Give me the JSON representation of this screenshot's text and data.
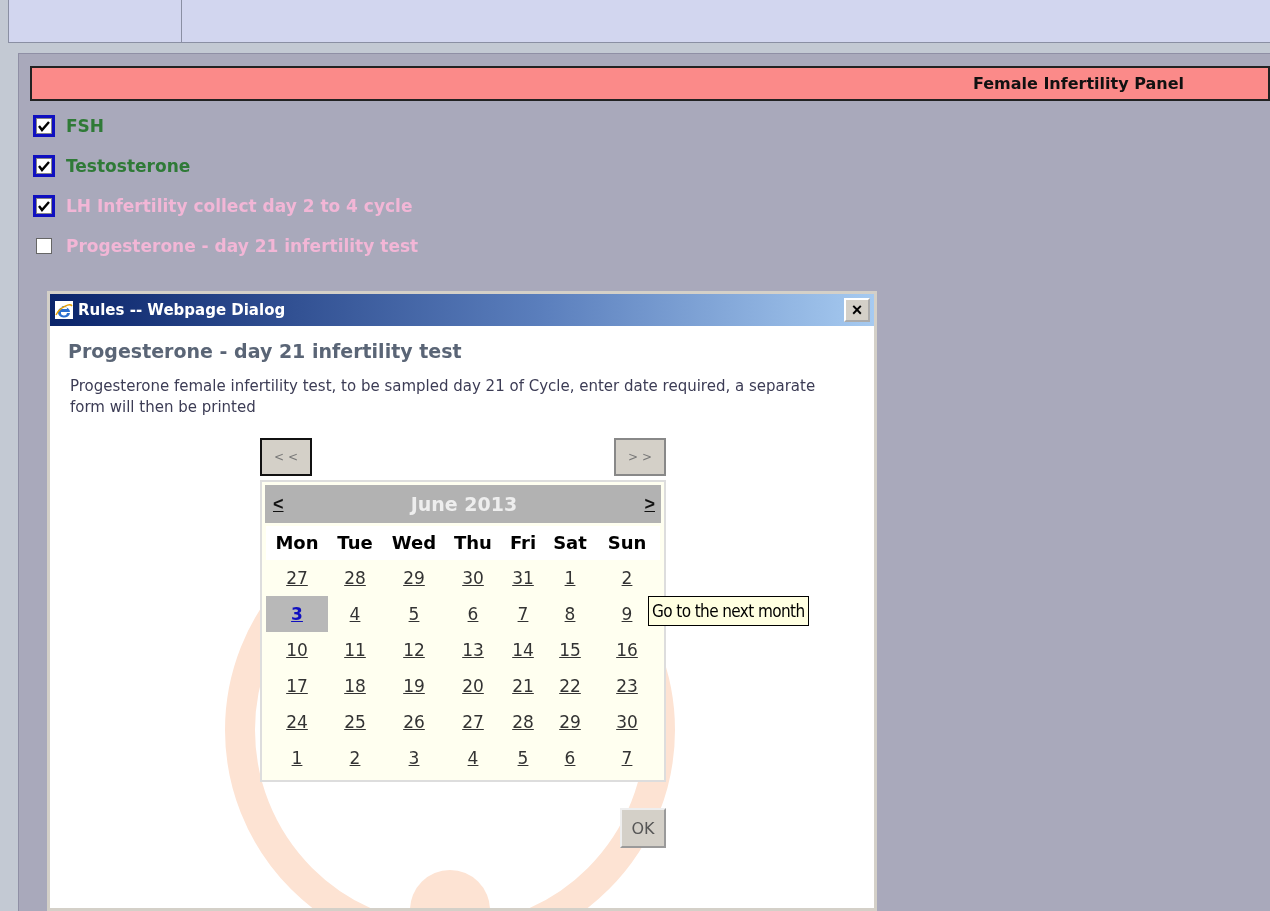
{
  "panel": {
    "title": "Female Infertility Panel",
    "tests": [
      {
        "label": "FSH",
        "checked": true,
        "color": "#2f7a37"
      },
      {
        "label": "Testosterone",
        "checked": true,
        "color": "#2f7a37"
      },
      {
        "label": "LH Infertility collect day 2 to 4 cycle",
        "checked": true,
        "color": "#f2b6d6"
      },
      {
        "label": "Progesterone - day 21 infertility test",
        "checked": false,
        "color": "#f2b6d6"
      }
    ]
  },
  "dialog": {
    "title": "Rules -- Webpage Dialog",
    "close": "×",
    "heading": "Progesterone - day 21 infertility test",
    "description": "Progesterone female infertility test, to be sampled day 21 of Cycle, enter date required, a separate form will then be printed",
    "prev_year": "< <",
    "next_year": "> >",
    "calendar": {
      "prev_month": "<",
      "month": "June 2013",
      "next_month": ">",
      "weekdays": [
        "Mon",
        "Tue",
        "Wed",
        "Thu",
        "Fri",
        "Sat",
        "Sun"
      ],
      "weeks": [
        [
          {
            "day": "27",
            "selected": false
          },
          {
            "day": "28",
            "selected": false
          },
          {
            "day": "29",
            "selected": false
          },
          {
            "day": "30",
            "selected": false
          },
          {
            "day": "31",
            "selected": false
          },
          {
            "day": "1",
            "selected": false
          },
          {
            "day": "2",
            "selected": false
          }
        ],
        [
          {
            "day": "3",
            "selected": true
          },
          {
            "day": "4",
            "selected": false
          },
          {
            "day": "5",
            "selected": false
          },
          {
            "day": "6",
            "selected": false
          },
          {
            "day": "7",
            "selected": false
          },
          {
            "day": "8",
            "selected": false
          },
          {
            "day": "9",
            "selected": false
          }
        ],
        [
          {
            "day": "10",
            "selected": false
          },
          {
            "day": "11",
            "selected": false
          },
          {
            "day": "12",
            "selected": false
          },
          {
            "day": "13",
            "selected": false
          },
          {
            "day": "14",
            "selected": false
          },
          {
            "day": "15",
            "selected": false
          },
          {
            "day": "16",
            "selected": false
          }
        ],
        [
          {
            "day": "17",
            "selected": false
          },
          {
            "day": "18",
            "selected": false
          },
          {
            "day": "19",
            "selected": false
          },
          {
            "day": "20",
            "selected": false
          },
          {
            "day": "21",
            "selected": false
          },
          {
            "day": "22",
            "selected": false
          },
          {
            "day": "23",
            "selected": false
          }
        ],
        [
          {
            "day": "24",
            "selected": false
          },
          {
            "day": "25",
            "selected": false
          },
          {
            "day": "26",
            "selected": false
          },
          {
            "day": "27",
            "selected": false
          },
          {
            "day": "28",
            "selected": false
          },
          {
            "day": "29",
            "selected": false
          },
          {
            "day": "30",
            "selected": false
          }
        ],
        [
          {
            "day": "1",
            "selected": false
          },
          {
            "day": "2",
            "selected": false
          },
          {
            "day": "3",
            "selected": false
          },
          {
            "day": "4",
            "selected": false
          },
          {
            "day": "5",
            "selected": false
          },
          {
            "day": "6",
            "selected": false
          },
          {
            "day": "7",
            "selected": false
          }
        ]
      ]
    },
    "tooltip": "Go to the next month",
    "ok": "OK"
  }
}
